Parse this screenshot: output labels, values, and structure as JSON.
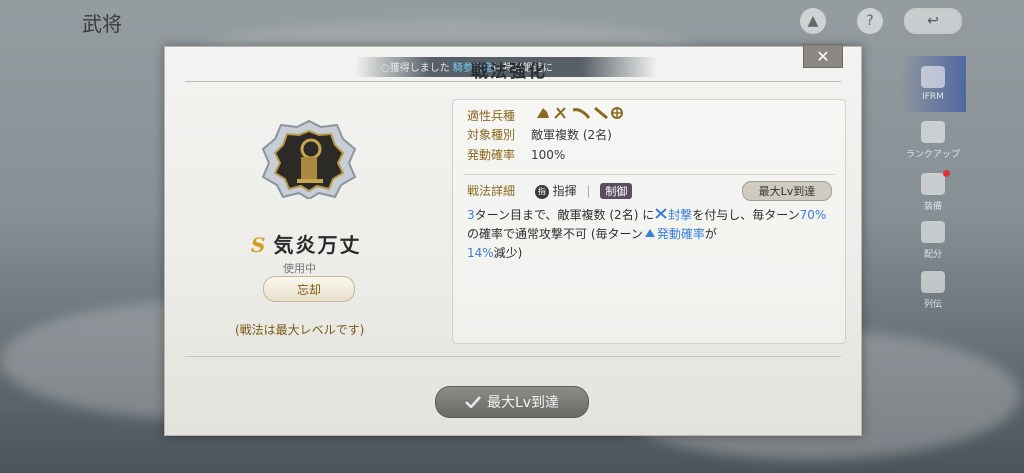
{
  "screen": {
    "title": "武将"
  },
  "sidebar": {
    "items": [
      {
        "label": "IFRM"
      },
      {
        "label": "ランクアップ"
      },
      {
        "label": "装備"
      },
      {
        "label": "配分"
      },
      {
        "label": "列伝"
      }
    ]
  },
  "modal": {
    "title": "戦法強化",
    "notice_prefix": "○獲得しました",
    "notice_highlight": "騎参斬竜",
    "notice_suffix": "は特級鍛造に",
    "close_label": "✕",
    "skill": {
      "grade": "S",
      "name": "気炎万丈",
      "status": "使用中",
      "forget_label": "忘却",
      "max_note": "(戦法は最大レベルです)"
    },
    "details": {
      "troop_label": "適性兵種",
      "target_label": "対象種別",
      "target_value": "敵軍複数 (2名)",
      "rate_label": "発動確率",
      "rate_value": "100%",
      "detail_label": "戦法詳細",
      "command_label": "指揮",
      "control_label": "制御",
      "max_badge": "最大Lv到達",
      "desc_1": "3",
      "desc_2": "ターン目まで、敵軍複数 (2名) に",
      "desc_3": "封撃",
      "desc_4": "を付与し、毎ターン",
      "desc_5": "70%",
      "desc_6": "の確率で通常攻撃不可 (毎ターン",
      "desc_7": "発動確率",
      "desc_8": "が",
      "desc_9": "14%",
      "desc_10": "減少)"
    },
    "confirm_label": "最大Lv到達"
  },
  "colors": {
    "accent_blue": "#3a7fd6",
    "gold": "#8a6a1e",
    "grade": "#d79b1c"
  }
}
